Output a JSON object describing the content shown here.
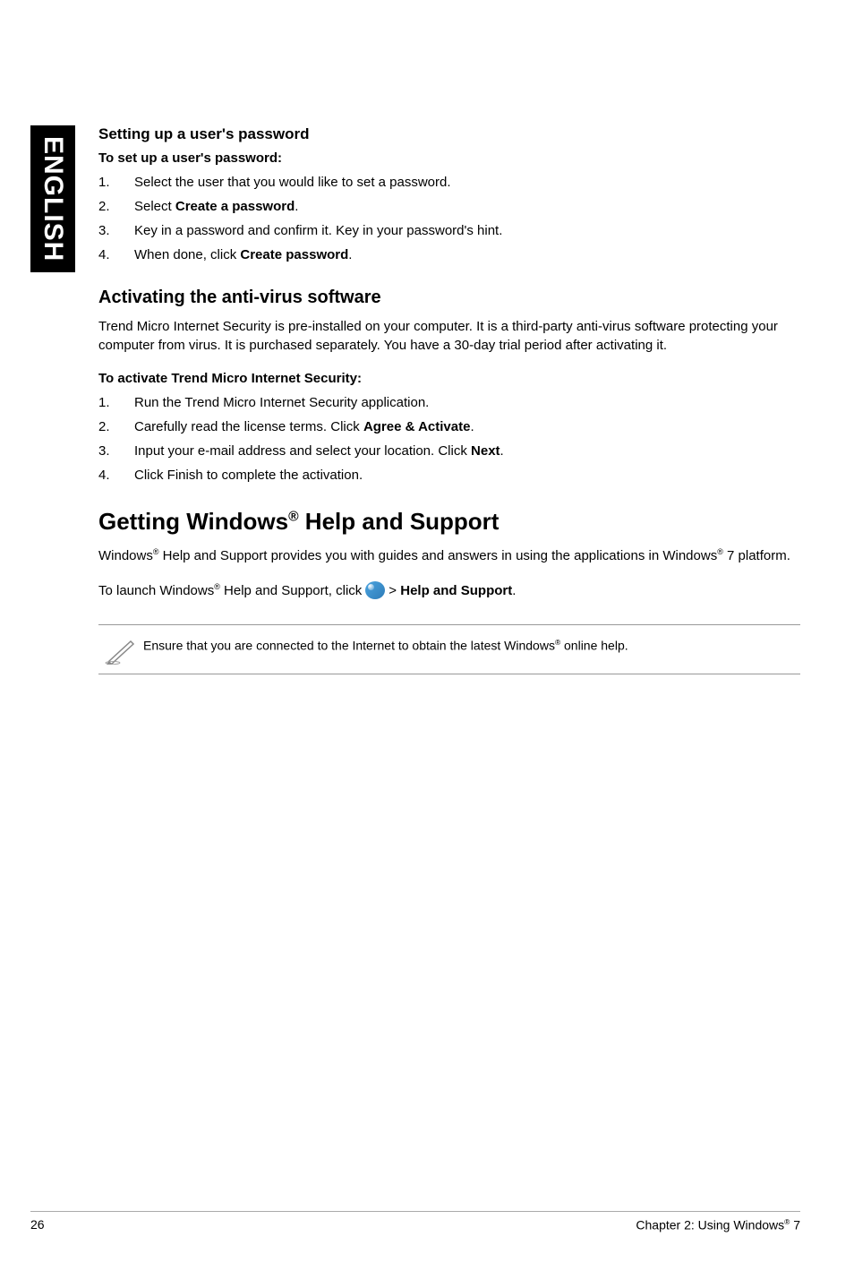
{
  "sideTab": "ENGLISH",
  "section1": {
    "heading": "Setting up a user's password",
    "subheading": "To set up a user's password:",
    "steps": [
      {
        "num": "1.",
        "text_pre": "Select the user that you would like to set a password."
      },
      {
        "num": "2.",
        "text_pre": "Select ",
        "bold": "Create a password",
        "text_post": "."
      },
      {
        "num": "3.",
        "text_pre": "Key in a password and confirm it. Key in your password's hint."
      },
      {
        "num": "4.",
        "text_pre": "When done, click ",
        "bold": "Create password",
        "text_post": "."
      }
    ]
  },
  "section2": {
    "heading": "Activating the anti-virus software",
    "body": "Trend Micro Internet Security is pre-installed on your computer. It is a third-party anti-virus software protecting your computer from virus. It is purchased separately. You have a 30-day trial period after activating it.",
    "subheading": "To activate Trend Micro Internet Security:",
    "steps": [
      {
        "num": "1.",
        "text_pre": "Run the Trend Micro Internet Security application."
      },
      {
        "num": "2.",
        "text_pre": "Carefully read the license terms. Click ",
        "bold": "Agree & Activate",
        "text_post": "."
      },
      {
        "num": "3.",
        "text_pre": "Input your e-mail address and select your location. Click ",
        "bold": "Next",
        "text_post": "."
      },
      {
        "num": "4.",
        "text_pre": "Click Finish to complete the activation."
      }
    ]
  },
  "section3": {
    "title_pre": "Getting Windows",
    "title_sup": "®",
    "title_post": " Help and Support",
    "body_pre": "Windows",
    "body_sup1": "®",
    "body_mid": " Help and Support provides you with guides and answers in using the applications in Windows",
    "body_sup2": "®",
    "body_post": " 7 platform.",
    "launch_pre": "To launch Windows",
    "launch_sup": "®",
    "launch_mid": " Help and Support, click ",
    "launch_gt": " > ",
    "launch_bold": "Help and Support",
    "launch_post": ".",
    "note_pre": "Ensure that you are connected to the Internet to obtain the latest Windows",
    "note_sup": "®",
    "note_post": " online help."
  },
  "footer": {
    "pageNum": "26",
    "chapter_pre": "Chapter 2: Using Windows",
    "chapter_sup": "®",
    "chapter_post": " 7"
  }
}
